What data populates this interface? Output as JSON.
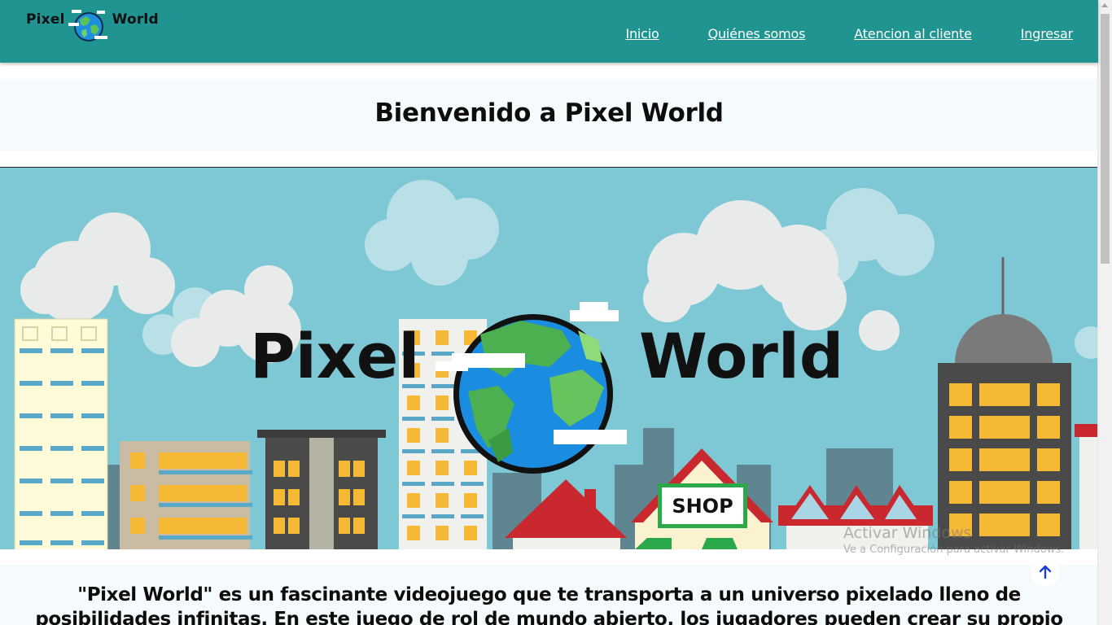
{
  "navbar": {
    "brand_left": "Pixel",
    "brand_right": "World",
    "links": [
      "Inicio",
      "Quiénes somos",
      "Atencion al cliente",
      "Ingresar"
    ]
  },
  "page_title": "Bienvenido a Pixel World",
  "hero": {
    "logo_left": "Pixel",
    "logo_right": "World",
    "shop_sign": "SHOP"
  },
  "description": "\"Pixel World\" es un fascinante videojuego que te transporta a un universo pixelado lleno de posibilidades infinitas. En este juego de rol de mundo abierto, los jugadores pueden crear su propio avatar y",
  "watermark": {
    "title": "Activar Windows",
    "subtitle": "Ve a Configuración para activar Windows."
  },
  "icons": {
    "back_to_top": "arrow-up-icon",
    "logo": "globe-icon"
  },
  "colors": {
    "navbar": "#209490",
    "sky": "#7ec8d6",
    "back_to_top_arrow": "#1d3fd9"
  }
}
